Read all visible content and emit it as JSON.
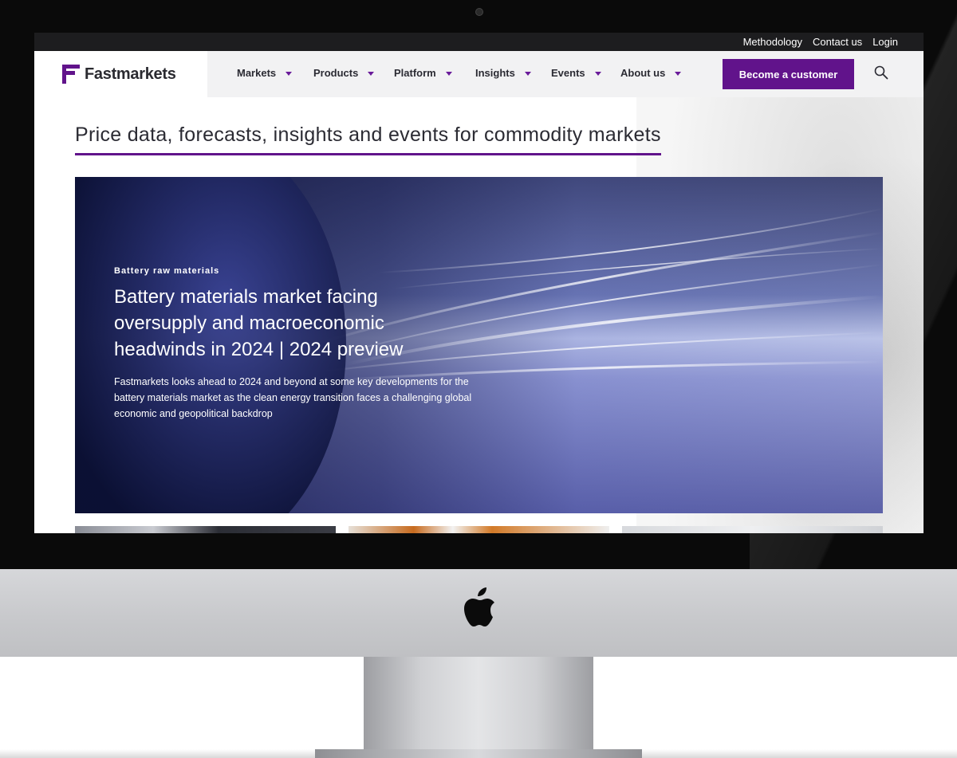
{
  "utility_nav": {
    "links": [
      "Methodology",
      "Contact us",
      "Login"
    ]
  },
  "brand": {
    "name": "Fastmarkets",
    "color": "#61138b"
  },
  "main_nav": {
    "items": [
      "Markets",
      "Products",
      "Platform",
      "Insights",
      "Events",
      "About us"
    ],
    "cta_label": "Become a customer",
    "search_icon": "search-icon"
  },
  "page": {
    "headline": "Price data, forecasts, insights and events for commodity markets"
  },
  "hero": {
    "category": "Battery raw materials",
    "title": "Battery materials market facing oversupply and macroeconomic headwinds in 2024 | 2024 preview",
    "summary": "Fastmarkets looks ahead to 2024 and beyond at some key developments for the battery materials market as the clean energy transition faces a challenging global economic and geopolitical backdrop"
  },
  "device": {
    "logo_icon": "apple-logo-icon"
  }
}
